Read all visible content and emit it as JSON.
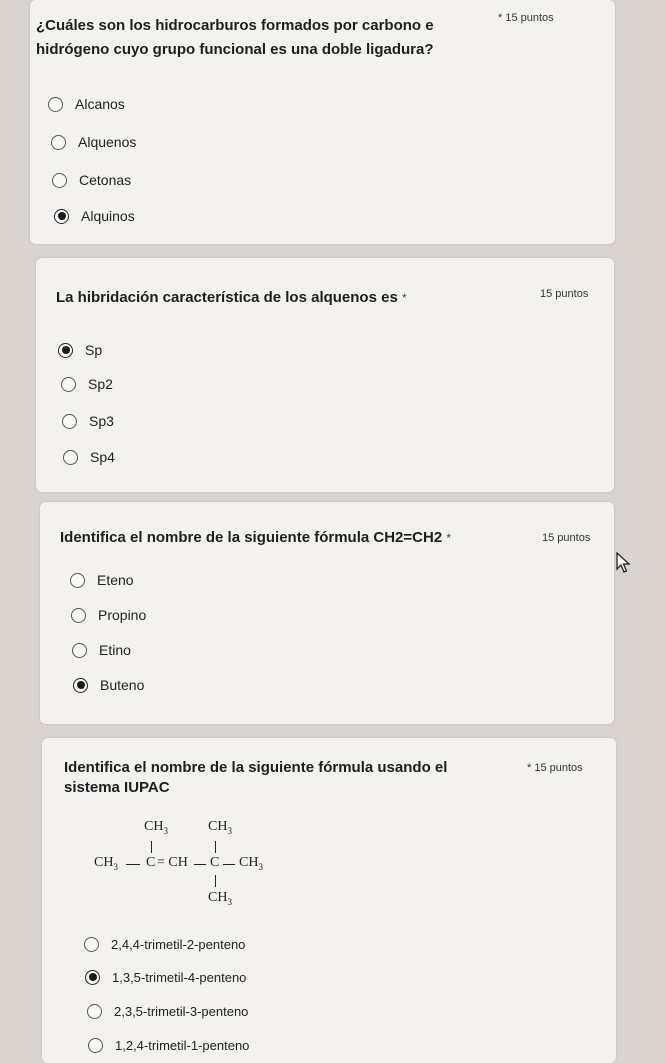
{
  "questions": [
    {
      "text": "¿Cuáles son los hidrocarburos formados por carbono e hidrógeno cuyo grupo funcional es una doble ligadura?",
      "line1": "¿Cuáles son los hidrocarburos formados por carbono e",
      "line2": "hidrógeno cuyo grupo funcional es una doble ligadura?",
      "points": "15 puntos",
      "required_mark": "*",
      "options": [
        "Alcanos",
        "Alquenos",
        "Cetonas",
        "Alquinos"
      ],
      "selected_index": 3
    },
    {
      "text": "La hibridación característica de los alquenos es",
      "points": "15 puntos",
      "required_mark": "*",
      "options": [
        "Sp",
        "Sp2",
        "Sp3",
        "Sp4"
      ],
      "selected_index": 0
    },
    {
      "text": "Identifica el nombre de la siguiente fórmula CH2=CH2",
      "points": "15 puntos",
      "required_mark": "*",
      "options": [
        "Eteno",
        "Propino",
        "Etino",
        "Buteno"
      ],
      "selected_index": 3
    },
    {
      "line1": "Identifica el nombre de la siguiente fórmula usando el",
      "line2": "sistema IUPAC",
      "points": "15 puntos",
      "required_mark": "*",
      "formula": {
        "top_ch3_1": "CH3",
        "top_ch3_2": "CH3",
        "main_left": "CH3",
        "main_c": "C",
        "main_eq_ch": "= CH",
        "main_c2": "C",
        "main_right": "CH3",
        "bottom_ch3": "CH3"
      },
      "options": [
        "2,4,4-trimetil-2-penteno",
        "1,3,5-trimetil-4-penteno",
        "2,3,5-trimetil-3-penteno",
        "1,2,4-trimetil-1-penteno"
      ],
      "selected_index": 1
    }
  ]
}
